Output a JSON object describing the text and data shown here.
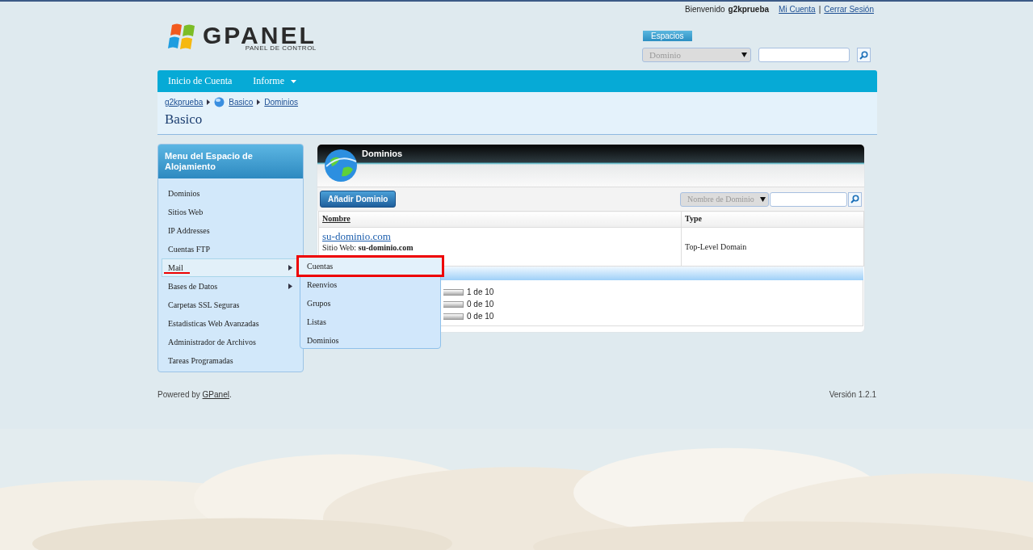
{
  "top_bar": {
    "welcome": "Bienvenido",
    "user": "g2kprueba",
    "links": [
      "Mi Cuenta",
      "Cerrar Sesión"
    ],
    "separator": "|"
  },
  "logo": {
    "name": "GPANEL",
    "tagline": "PANEL DE CONTROL"
  },
  "space_selector": {
    "tab": "Espacios",
    "dropdown": "Dominio"
  },
  "nav": [
    {
      "label": "Inicio de Cuenta",
      "has_menu": false
    },
    {
      "label": "Informe",
      "has_menu": true
    }
  ],
  "breadcrumb": [
    "g2kprueba",
    "Basico",
    "Dominios"
  ],
  "page_title": "Basico",
  "sidebar": {
    "title": "Menu del Espacio de Alojamiento",
    "items": [
      {
        "label": "Dominios",
        "selected": false,
        "has_submenu": false
      },
      {
        "label": "Sitios Web",
        "selected": false,
        "has_submenu": false
      },
      {
        "label": "IP Addresses",
        "selected": false,
        "has_submenu": false
      },
      {
        "label": "Cuentas FTP",
        "selected": false,
        "has_submenu": false
      },
      {
        "label": "Mail",
        "selected": true,
        "has_submenu": true
      },
      {
        "label": "Bases de Datos",
        "selected": false,
        "has_submenu": true
      },
      {
        "label": "Carpetas SSL Seguras",
        "selected": false,
        "has_submenu": false
      },
      {
        "label": "Estadisticas Web Avanzadas",
        "selected": false,
        "has_submenu": false
      },
      {
        "label": "Administrador de Archivos",
        "selected": false,
        "has_submenu": false
      },
      {
        "label": "Tareas Programadas",
        "selected": false,
        "has_submenu": false
      }
    ]
  },
  "submenu": [
    {
      "label": "Cuentas",
      "selected": true
    },
    {
      "label": "Reenvios",
      "selected": false
    },
    {
      "label": "Grupos",
      "selected": false
    },
    {
      "label": "Listas",
      "selected": false
    },
    {
      "label": "Dominios",
      "selected": false
    }
  ],
  "panel": {
    "title": "Dominios",
    "add_button": "Añadir Dominio",
    "filter": "Nombre de Dominio",
    "columns": [
      "Nombre",
      "Type"
    ],
    "rows": [
      {
        "domain": "su-dominio.com",
        "site_label": "Sitio Web:",
        "site": "su-dominio.com",
        "type": "Top-Level Domain"
      }
    ],
    "quotas": [
      "1 de 10",
      "0 de 10",
      "0 de 10"
    ]
  },
  "footer": {
    "powered": "Powered by",
    "link": "GPanel",
    "end": ".",
    "version": "Versión 1.2.1"
  }
}
